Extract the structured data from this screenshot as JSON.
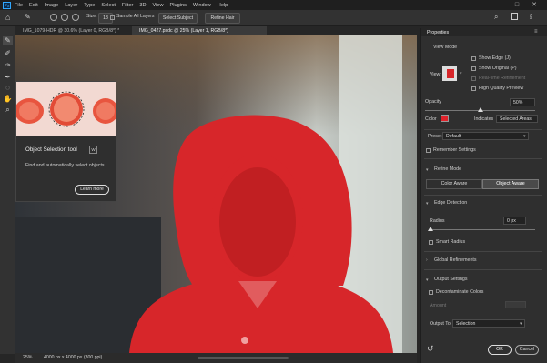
{
  "app": {
    "logo_text": "Ps"
  },
  "menu": [
    "File",
    "Edit",
    "Image",
    "Layer",
    "Type",
    "Select",
    "Filter",
    "3D",
    "View",
    "Plugins",
    "Window",
    "Help"
  ],
  "options": {
    "size_label": "Size:",
    "size_value": "13",
    "sample_all_layers": "Sample All Layers",
    "select_subject": "Select Subject",
    "refine_hair": "Refine Hair"
  },
  "tabs": [
    {
      "label": "IMG_1079-HDR @ 30.6% (Layer 0, RGB/8*) *"
    },
    {
      "label": "IMG_0427.psdc @ 25% (Layer 1, RGB/8*)"
    }
  ],
  "tooltip": {
    "title": "Object Selection tool",
    "badge": "W",
    "description": "Find and automatically select objects",
    "learn_more": "Learn more"
  },
  "status": {
    "zoom": "25%",
    "doc_size": "4000 px x 4000 px (300 ppi)"
  },
  "properties": {
    "title": "Properties",
    "view_mode_label": "View Mode",
    "view_label": "View:",
    "show_edge": "Show Edge (J)",
    "show_original": "Show Original (P)",
    "realtime_refinement": "Real-time Refinement",
    "high_quality_preview": "High Quality Preview",
    "opacity_label": "Opacity",
    "opacity_value": "50%",
    "opacity_level": 0.5,
    "color_label": "Color",
    "overlay_color": "#e0222a",
    "indicates_label": "Indicates",
    "indicates_value": "Selected Areas",
    "preset_label": "Preset",
    "preset_value": "Default",
    "remember_settings": "Remember Settings",
    "refine_mode": "Refine Mode",
    "color_aware": "Color Aware",
    "object_aware": "Object Aware",
    "edge_detection": "Edge Detection",
    "radius_label": "Radius",
    "radius_value": "0 px",
    "smart_radius": "Smart Radius",
    "global_refinements": "Global Refinements",
    "output_settings": "Output Settings",
    "decontaminate": "Decontaminate Colors",
    "amount_label": "Amount",
    "output_to_label": "Output To",
    "output_to_value": "Selection",
    "ok": "OK",
    "cancel": "Cancel"
  },
  "colors": {
    "accent": "#31a8ff",
    "selection_overlay": "#e0222a"
  }
}
